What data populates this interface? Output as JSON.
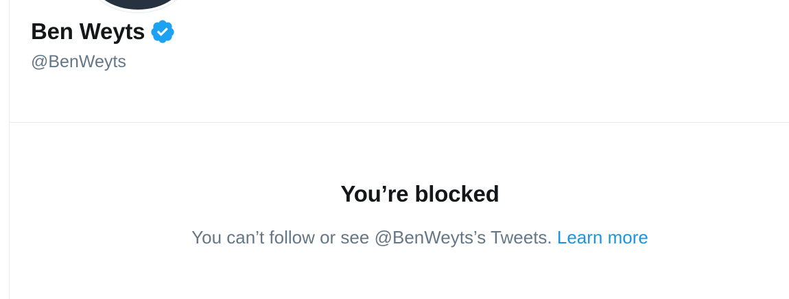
{
  "profile": {
    "display_name": "Ben Weyts",
    "handle": "@BenWeyts",
    "verified_icon": "verified-badge-icon",
    "verified_color": "#1da1f2"
  },
  "blocked": {
    "title": "You’re blocked",
    "message": "You can’t follow or see @BenWeyts’s Tweets.",
    "learn_more": "Learn more",
    "link_color": "#1b95e0"
  }
}
